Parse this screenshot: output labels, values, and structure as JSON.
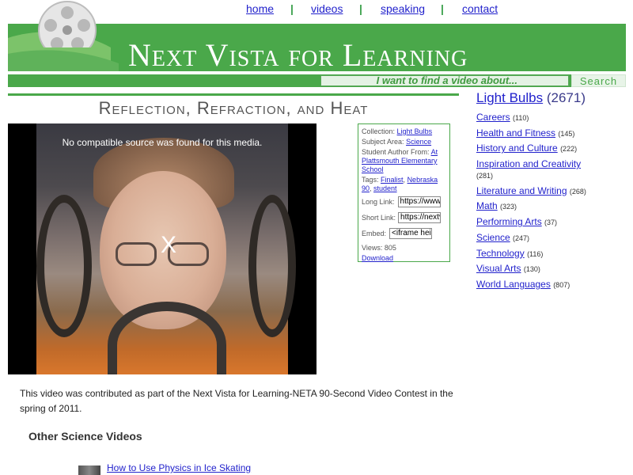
{
  "nav": {
    "home": "home",
    "videos": "videos",
    "speaking": "speaking",
    "contact": "contact",
    "separator": "|"
  },
  "banner": {
    "title": "Next Vista for Learning"
  },
  "search": {
    "placeholder": "I want to find a video about...",
    "button": "Search"
  },
  "video": {
    "title": "Reflection, Refraction, and Heat",
    "player_message": "No compatible source was found for this media.",
    "close_glyph": "X"
  },
  "info": {
    "collection_label": "Collection:",
    "collection": "Light Bulbs",
    "subject_label": "Subject Area:",
    "subject": "Science",
    "author_label": "Student Author From:",
    "author_link": "At Plattsmouth Elementary School",
    "tags_label": "Tags:",
    "tags": [
      "Finalist",
      "Nebraska 90",
      "student"
    ],
    "long_link_label": "Long Link:",
    "long_link_value": "https://www.nextvista.org",
    "short_link_label": "Short Link:",
    "short_link_value": "https://nextv.is",
    "embed_label": "Embed:",
    "embed_value": "<iframe height",
    "views_label": "Views:",
    "views": "805",
    "download": "Download"
  },
  "description": "This video was contributed as part of the Next Vista for Learning-NETA 90-Second Video Contest in the spring of 2011.",
  "other": {
    "heading": "Other Science Videos",
    "first_link": "How to Use Physics in Ice Skating"
  },
  "sidebar": {
    "heading_link": "Light Bulbs",
    "heading_count": "(2671)",
    "categories": [
      {
        "label": "Careers",
        "count": "(110)"
      },
      {
        "label": "Health and Fitness",
        "count": "(145)"
      },
      {
        "label": "History and Culture",
        "count": "(222)"
      },
      {
        "label": "Inspiration and Creativity",
        "count": "(281)"
      },
      {
        "label": "Literature and Writing",
        "count": "(268)"
      },
      {
        "label": "Math",
        "count": "(323)"
      },
      {
        "label": "Performing Arts",
        "count": "(37)"
      },
      {
        "label": "Science",
        "count": "(247)"
      },
      {
        "label": "Technology",
        "count": "(116)"
      },
      {
        "label": "Visual Arts",
        "count": "(130)"
      },
      {
        "label": "World Languages",
        "count": "(807)"
      }
    ]
  },
  "colors": {
    "brand_green": "#4aa84a",
    "link_blue": "#2222cc"
  }
}
